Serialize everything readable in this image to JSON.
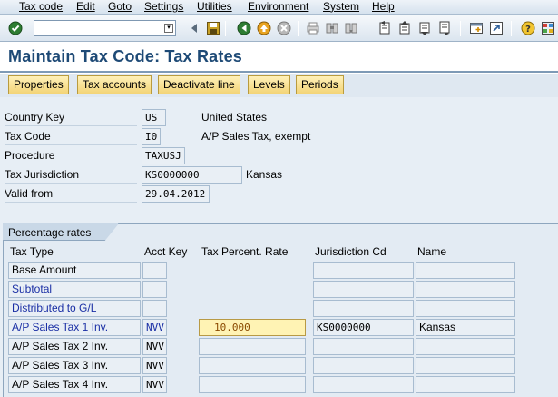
{
  "menu": {
    "items": [
      "Tax code",
      "Edit",
      "Goto",
      "Settings",
      "Utilities",
      "Environment",
      "System",
      "Help"
    ]
  },
  "toolbar": {
    "command_field_value": "",
    "icons": [
      "enter-icon",
      "back-icon",
      "save-icon",
      "back-green-icon",
      "exit-icon",
      "cancel-icon",
      "print-icon",
      "find-icon",
      "find-next-icon",
      "first-page-icon",
      "previous-page-icon",
      "next-page-icon",
      "last-page-icon",
      "create-session-icon",
      "shortcut-icon",
      "help-icon",
      "layout-menu-icon"
    ]
  },
  "header": {
    "title": "Maintain Tax Code: Tax Rates"
  },
  "app_toolbar": {
    "buttons": [
      "Properties",
      "Tax accounts",
      "Deactivate line",
      "Levels",
      "Periods"
    ]
  },
  "fields": {
    "country_key": {
      "label": "Country Key",
      "value": "US",
      "description": "United States"
    },
    "tax_code": {
      "label": "Tax Code",
      "value": "I0",
      "description": "A/P Sales Tax, exempt"
    },
    "procedure": {
      "label": "Procedure",
      "value": "TAXUSJ"
    },
    "tax_jurisdiction": {
      "label": "Tax Jurisdiction",
      "value": "KS0000000",
      "description": "Kansas"
    },
    "valid_from": {
      "label": "Valid from",
      "value": "29.04.2012"
    }
  },
  "rates_table": {
    "section_title": "Percentage rates",
    "columns": [
      "Tax Type",
      "Acct Key",
      "Tax Percent. Rate",
      "Jurisdiction Cd",
      "Name"
    ],
    "rows": [
      {
        "tax_type": "Base Amount",
        "acct_key": "",
        "rate": "",
        "jurisdiction": "",
        "name": ""
      },
      {
        "tax_type": "Subtotal",
        "acct_key": "",
        "rate": "",
        "jurisdiction": "",
        "name": ""
      },
      {
        "tax_type": "Distributed to G/L",
        "acct_key": "",
        "rate": "",
        "jurisdiction": "",
        "name": ""
      },
      {
        "tax_type": "A/P Sales Tax 1 Inv.",
        "acct_key": "NVV",
        "rate": "10.000",
        "jurisdiction": "KS0000000",
        "name": "Kansas"
      },
      {
        "tax_type": "A/P Sales Tax 2 Inv.",
        "acct_key": "NVV",
        "rate": "",
        "jurisdiction": "",
        "name": ""
      },
      {
        "tax_type": "A/P Sales Tax 3 Inv.",
        "acct_key": "NVV",
        "rate": "",
        "jurisdiction": "",
        "name": ""
      },
      {
        "tax_type": "A/P Sales Tax 4 Inv.",
        "acct_key": "NVV",
        "rate": "",
        "jurisdiction": "",
        "name": ""
      }
    ]
  }
}
